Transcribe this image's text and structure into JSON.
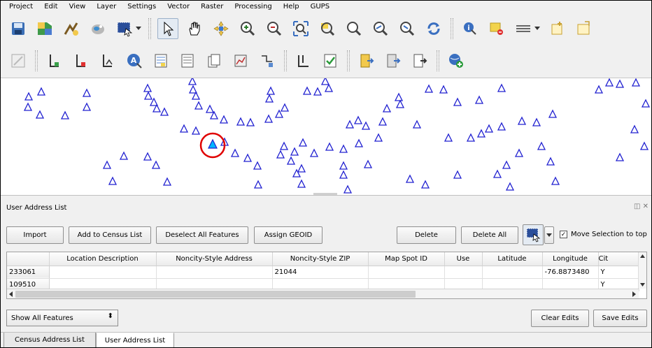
{
  "menu": [
    "Project",
    "Edit",
    "View",
    "Layer",
    "Settings",
    "Vector",
    "Raster",
    "Processing",
    "Help",
    "GUPS"
  ],
  "toolbar1_icons": [
    "save-icon",
    "layer-map-icon",
    "digitize-icon",
    "print-composer-icon",
    "select-rect-icon",
    "pointer-icon",
    "pan-hand-icon",
    "pan-to-selection-icon",
    "zoom-in-icon",
    "zoom-out-icon",
    "zoom-full-icon",
    "zoom-to-selection-icon",
    "zoom-to-layer-icon",
    "zoom-last-icon",
    "zoom-next-icon",
    "refresh-icon",
    "identify-icon",
    "deselect-icon",
    "measure-icon",
    "new-bookmark-icon",
    "show-bookmarks-icon"
  ],
  "toolbar2_icons": [
    "edit-disabled-icon",
    "add-layer-icon",
    "remove-layer-icon",
    "layer-style-icon",
    "geoid-icon",
    "table-icon",
    "list-icon",
    "copy-icon",
    "chart-icon",
    "merge-icon",
    "check-icon",
    "validate-icon",
    "export-icon",
    "import-icon",
    "report-icon",
    "add-globe-icon"
  ],
  "panel": {
    "title": "User Address List",
    "buttons": {
      "import": "Import",
      "add_census": "Add to Census List",
      "deselect": "Deselect All Features",
      "assign_geoid": "Assign GEOID",
      "delete": "Delete",
      "delete_all": "Delete All"
    },
    "move_selection_label": "Move Selection to top",
    "move_selection_checked": true,
    "columns": [
      "",
      "Location Description",
      "Noncity-Style Address",
      "Noncity-Style ZIP",
      "Map Spot ID",
      "Use",
      "Latitude",
      "Longitude",
      "Cit"
    ],
    "rows": [
      [
        "233061",
        "",
        "",
        "21044",
        "",
        "",
        "",
        "-76.8873480",
        "Y"
      ],
      [
        "109510",
        "",
        "",
        "",
        "",
        "",
        "",
        "",
        "Y"
      ]
    ],
    "filter_value": "Show All Features",
    "clear_edits": "Clear Edits",
    "save_edits": "Save Edits"
  },
  "tabs": [
    "Census Address List",
    "User Address List"
  ],
  "active_tab": "User Address List",
  "colors": {
    "point_stroke": "#2020d0",
    "selected_fill": "#00b4ff",
    "highlight_ring": "#e00000"
  }
}
